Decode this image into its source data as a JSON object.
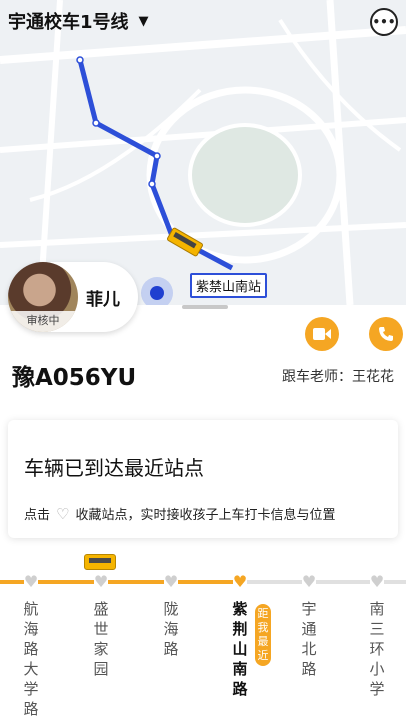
{
  "header": {
    "route_title": "宇通校车1号线",
    "caret": "▼"
  },
  "map": {
    "station_label": "紫禁山南站",
    "route_color": "#2d4fd8"
  },
  "user": {
    "name": "菲儿",
    "status": "审核中"
  },
  "bus": {
    "plate": "豫A056YU",
    "teacher": "跟车老师：王花花"
  },
  "info_card": {
    "title": "车辆已到达最近站点",
    "desc_prefix": "点击",
    "desc_suffix": "收藏站点，实时接收孩子上车打卡信息与位置"
  },
  "stops": [
    {
      "name": "航海路大学路",
      "active": false
    },
    {
      "name": "盛世家园",
      "active": false
    },
    {
      "name": "陇海路",
      "active": false
    },
    {
      "name": "紫荆山南路",
      "active": true
    },
    {
      "name": "宇通北路",
      "active": false
    },
    {
      "name": "南三环小学",
      "active": false
    }
  ],
  "near_badge": "距我最近",
  "icons": {
    "chat": "chat-icon",
    "video": "video-icon",
    "phone": "phone-icon",
    "heart": "heart-icon",
    "bus": "bus-icon"
  },
  "colors": {
    "accent": "#f5a623",
    "route": "#2d4fd8"
  }
}
